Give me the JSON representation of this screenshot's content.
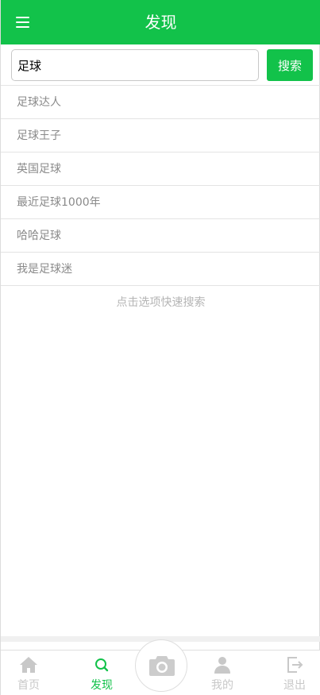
{
  "header": {
    "title": "发现",
    "menu_icon": "hamburger-icon"
  },
  "search": {
    "value": "足球",
    "button_label": "搜索"
  },
  "suggestions": [
    {
      "label": "足球达人"
    },
    {
      "label": "足球王子"
    },
    {
      "label": "英国足球"
    },
    {
      "label": "最近足球1000年"
    },
    {
      "label": "哈哈足球"
    },
    {
      "label": "我是足球迷"
    }
  ],
  "hint": "点击选项快速搜索",
  "bottom_nav": {
    "items": [
      {
        "label": "首页",
        "icon": "home-icon",
        "active": false
      },
      {
        "label": "发现",
        "icon": "search-icon",
        "active": true
      },
      {
        "label": "我的",
        "icon": "user-icon",
        "active": false
      },
      {
        "label": "退出",
        "icon": "logout-icon",
        "active": false
      }
    ],
    "camera_icon": "camera-icon"
  },
  "colors": {
    "accent": "#12c24a",
    "muted_text": "#8a8a8a",
    "hint_text": "#b5b5b5",
    "inactive_nav": "#c8c8c8"
  }
}
